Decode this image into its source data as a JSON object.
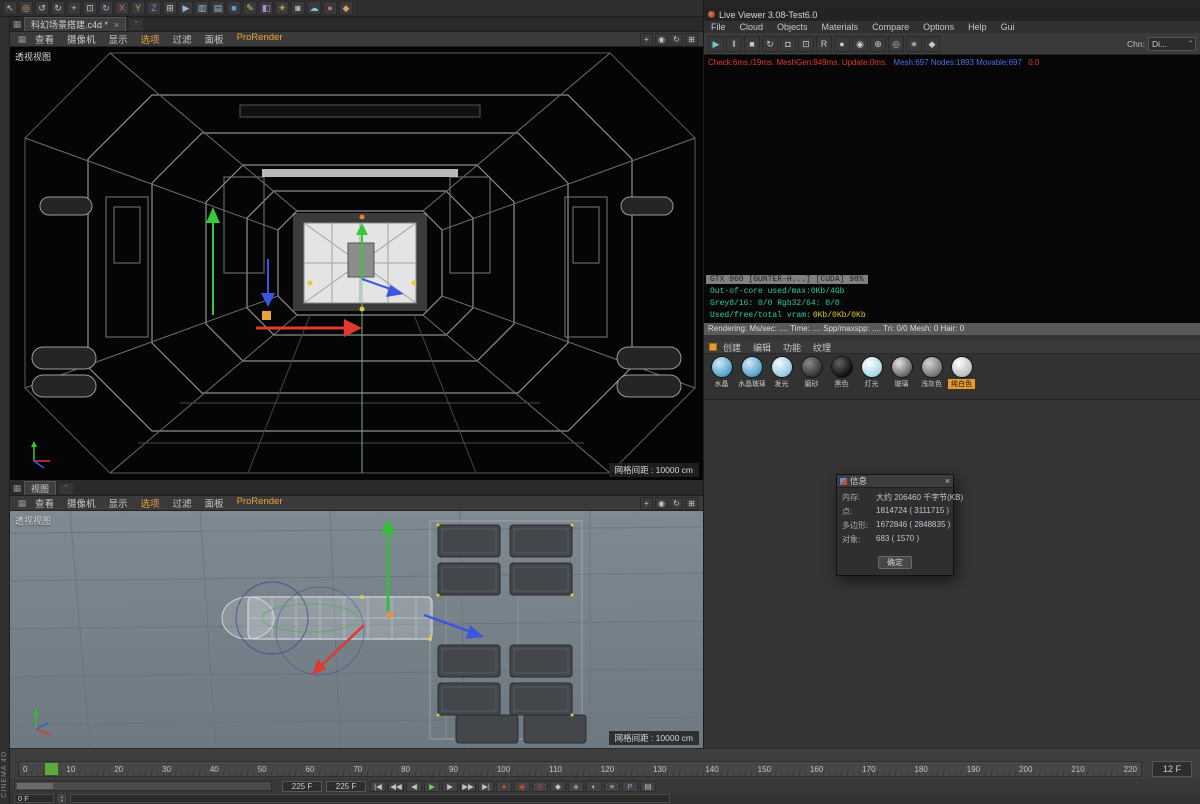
{
  "brand": {
    "vertical_label": "CINEMA 4D"
  },
  "doc_tab": {
    "title": "科幻场景搭建.c4d *",
    "close_glyph": "×",
    "dropdown_glyph": "ˇ"
  },
  "viewport_menu": {
    "items": [
      "查看",
      "摄像机",
      "显示",
      "选项",
      "过滤",
      "面板",
      "ProRender"
    ]
  },
  "vp_nav": {
    "icons": [
      {
        "name": "pan-view-icon",
        "glyph": "+",
        "color": "#c9c9c9"
      },
      {
        "name": "zoom-view-icon",
        "glyph": "◉",
        "color": "#c9c9c9"
      },
      {
        "name": "rotate-view-icon",
        "glyph": "↻",
        "color": "#c9c9c9"
      },
      {
        "name": "toggle-views-icon",
        "glyph": "⊞",
        "color": "#c9c9c9"
      }
    ]
  },
  "viewport1": {
    "label": "透视视图",
    "grid": "网格间距 : 10000 cm"
  },
  "viewport2": {
    "tab": "视图",
    "label": "透视视图",
    "grid": "网格间距 : 10000 cm"
  },
  "main_toolbar": {
    "icons": [
      {
        "name": "select-tool-icon",
        "glyph": "↖",
        "color": "#c9c9c9"
      },
      {
        "name": "live-selection-icon",
        "glyph": "◎",
        "color": "#d8b36a"
      },
      {
        "name": "undo-icon",
        "glyph": "↺",
        "color": "#c9c9c9"
      },
      {
        "name": "redo-icon",
        "glyph": "↻",
        "color": "#c9c9c9"
      },
      {
        "name": "move-tool-icon",
        "glyph": "+",
        "color": "#c9c9c9"
      },
      {
        "name": "scale-tool-icon",
        "glyph": "⊡",
        "color": "#c9c9c9"
      },
      {
        "name": "rotate-tool-icon",
        "glyph": "↻",
        "color": "#8fb7d8"
      },
      {
        "name": "x-axis-lock-icon",
        "glyph": "X",
        "color": "#d06a5a"
      },
      {
        "name": "y-axis-lock-icon",
        "glyph": "Y",
        "color": "#7ec46a"
      },
      {
        "name": "z-axis-lock-icon",
        "glyph": "Z",
        "color": "#6a8fd0"
      },
      {
        "name": "coordinate-system-icon",
        "glyph": "⊞",
        "color": "#c9c9c9"
      },
      {
        "name": "render-view-icon",
        "glyph": "▶",
        "color": "#9ab7d8"
      },
      {
        "name": "picture-viewer-icon",
        "glyph": "▥",
        "color": "#9ab7d8"
      },
      {
        "name": "render-settings-icon",
        "glyph": "▤",
        "color": "#9ab7d8"
      },
      {
        "name": "primitive-cube-icon",
        "glyph": "■",
        "color": "#5aa0e0"
      },
      {
        "name": "spline-pen-icon",
        "glyph": "✎",
        "color": "#d8c46a"
      },
      {
        "name": "generators-icon",
        "glyph": "◧",
        "color": "#a98fd8"
      },
      {
        "name": "light-icon",
        "glyph": "☀",
        "color": "#e0c05a"
      },
      {
        "name": "camera-icon",
        "glyph": "◙",
        "color": "#b8b8b8"
      },
      {
        "name": "sky-icon",
        "glyph": "☁",
        "color": "#7ec4e0"
      },
      {
        "name": "material-icon",
        "glyph": "●",
        "color": "#c06a9a"
      },
      {
        "name": "snap-settings-icon",
        "glyph": "◆",
        "color": "#e0a05a"
      }
    ]
  },
  "timeline": {
    "ticks": [
      "0",
      "10",
      "20",
      "30",
      "40",
      "50",
      "60",
      "70",
      "80",
      "90",
      "100",
      "110",
      "120",
      "130",
      "140",
      "150",
      "160",
      "170",
      "180",
      "190",
      "200",
      "210",
      "220"
    ],
    "current_label": "12 F"
  },
  "transport": {
    "range_start": "225 F",
    "range_end": "225 F",
    "icons": [
      {
        "name": "goto-start-icon",
        "glyph": "|◀"
      },
      {
        "name": "prev-key-icon",
        "glyph": "◀◀"
      },
      {
        "name": "prev-frame-icon",
        "glyph": "◀"
      },
      {
        "name": "play-button",
        "glyph": "▶",
        "color": "#6fd06a"
      },
      {
        "name": "next-frame-icon",
        "glyph": "▶"
      },
      {
        "name": "next-key-icon",
        "glyph": "▶▶"
      },
      {
        "name": "goto-end-icon",
        "glyph": "▶|"
      },
      {
        "name": "record-keyframe-icon",
        "glyph": "●",
        "color": "#d04a3a"
      },
      {
        "name": "record-position-icon",
        "glyph": "◉",
        "color": "#d04a3a"
      },
      {
        "name": "autokey-icon",
        "glyph": "◎",
        "color": "#d04a3a"
      },
      {
        "name": "keyframe-selection-icon",
        "glyph": "◆"
      },
      {
        "name": "magnet-snap-icon",
        "glyph": "◈",
        "color": "#7ea8d0"
      },
      {
        "name": "solo-icon",
        "glyph": "◐"
      },
      {
        "name": "playback-settings-icon",
        "glyph": "≡"
      },
      {
        "name": "powerslider-icon",
        "glyph": "P",
        "color": "#7ea8d0"
      },
      {
        "name": "timeline-options-icon",
        "glyph": "▤"
      }
    ]
  },
  "statusbar": {
    "frame": "0 F"
  },
  "live_viewer": {
    "title": "Live Viewer 3.08-Test6.0",
    "menus": [
      "File",
      "Cloud",
      "Objects",
      "Materials",
      "Compare",
      "Options",
      "Help",
      "Gui"
    ],
    "toolbar_icons": [
      {
        "name": "render-start-icon",
        "glyph": "▶",
        "color": "#6fd0c0"
      },
      {
        "name": "pause-render-icon",
        "glyph": "‖",
        "color": "#c9c9c9"
      },
      {
        "name": "stop-render-icon",
        "glyph": "■",
        "color": "#c9c9c9"
      },
      {
        "name": "restart-render-icon",
        "glyph": "↻",
        "color": "#c9c9c9"
      },
      {
        "name": "lock-view-icon",
        "glyph": "◘",
        "color": "#c9c9c9"
      },
      {
        "name": "region-render-icon",
        "glyph": "⊡",
        "color": "#c9c9c9"
      },
      {
        "name": "render-region-reset-icon",
        "glyph": "R",
        "color": "#c9c9c9"
      },
      {
        "name": "clay-mode-icon",
        "glyph": "●",
        "color": "#c9c9c9"
      },
      {
        "name": "material-picker-icon",
        "glyph": "◉",
        "color": "#c9c9c9"
      },
      {
        "name": "focus-picker-icon",
        "glyph": "⊕",
        "color": "#c9c9c9"
      },
      {
        "name": "camera-sync-icon",
        "glyph": "◎",
        "color": "#c9c9c9"
      },
      {
        "name": "settings-gear-icon",
        "glyph": "∗",
        "color": "#c9c9c9"
      },
      {
        "name": "pin-window-icon",
        "glyph": "◆",
        "color": "#c9c9c9"
      }
    ],
    "chn_label": "Chn:",
    "chn_value": "Di...",
    "dropdown_glyph": "ˇ",
    "perf_red": "Check:6ms./19ms. MeshGen:949ms. Update:0ms.",
    "perf_blue": "Mesh:697 Nodes:1893 Movable:697",
    "perf_tail": "0.0",
    "device_line": "GTX 960 [GUNTER-H...] [CUDA] 98%",
    "oc_line": "Out-of-core used/max:0Kb/4Gb",
    "fmt_line": "Grey8/16: 0/0      Rgb32/64: 0/0",
    "vram_label": "Used/free/total vram:",
    "vram_value": "0Kb/0Kb/0Kb",
    "status_line": "Rendering:      Ms/sec: ....      Time: ....      Spp/maxspp: ....      Tri: 0/0    Mesh: 0    Hair: 0"
  },
  "material_manager": {
    "tabs": [
      "创建",
      "编辑",
      "功能",
      "纹理"
    ],
    "materials": [
      {
        "label": "水晶",
        "c1": "#cfeaf6",
        "c2": "#4f9cc4",
        "label_bg": "transparent",
        "label_color": "#c9c9c9"
      },
      {
        "label": "水晶玻璃",
        "c1": "#cfeaf6",
        "c2": "#4f9cc4",
        "label_bg": "transparent",
        "label_color": "#c9c9c9"
      },
      {
        "label": "发光",
        "c1": "#f2fafd",
        "c2": "#8fc6dd",
        "label_bg": "transparent",
        "label_color": "#c9c9c9"
      },
      {
        "label": "磨砂",
        "c1": "#8a8a8a",
        "c2": "#2e2e2e",
        "label_bg": "transparent",
        "label_color": "#c9c9c9"
      },
      {
        "label": "黑色",
        "c1": "#606060",
        "c2": "#0c0c0c",
        "label_bg": "transparent",
        "label_color": "#c9c9c9"
      },
      {
        "label": "灯光",
        "c1": "#ffffff",
        "c2": "#9fd8e4",
        "label_bg": "transparent",
        "label_color": "#c9c9c9"
      },
      {
        "label": "玻璃",
        "c1": "#e2e2e2",
        "c2": "#5f5f5f",
        "label_bg": "transparent",
        "label_color": "#c9c9c9"
      },
      {
        "label": "浅灰色",
        "c1": "#d4d4d4",
        "c2": "#6e6e6e",
        "label_bg": "transparent",
        "label_color": "#c9c9c9"
      },
      {
        "label": "纯白色",
        "c1": "#ffffff",
        "c2": "#b8b8b8",
        "label_bg": "#e79a2e",
        "label_color": "#1a1a1a"
      }
    ]
  },
  "info_dialog": {
    "title": "信息",
    "close_glyph": "×",
    "rows": [
      {
        "label": "内存:",
        "value": "大约 206460 千字节(KB)"
      },
      {
        "label": "点:",
        "value": "1814724 ( 3111715 )"
      },
      {
        "label": "多边形:",
        "value": "1672846 ( 2848835 )"
      },
      {
        "label": "对象:",
        "value": "683 ( 1570 )"
      }
    ],
    "ok_label": "确定"
  }
}
